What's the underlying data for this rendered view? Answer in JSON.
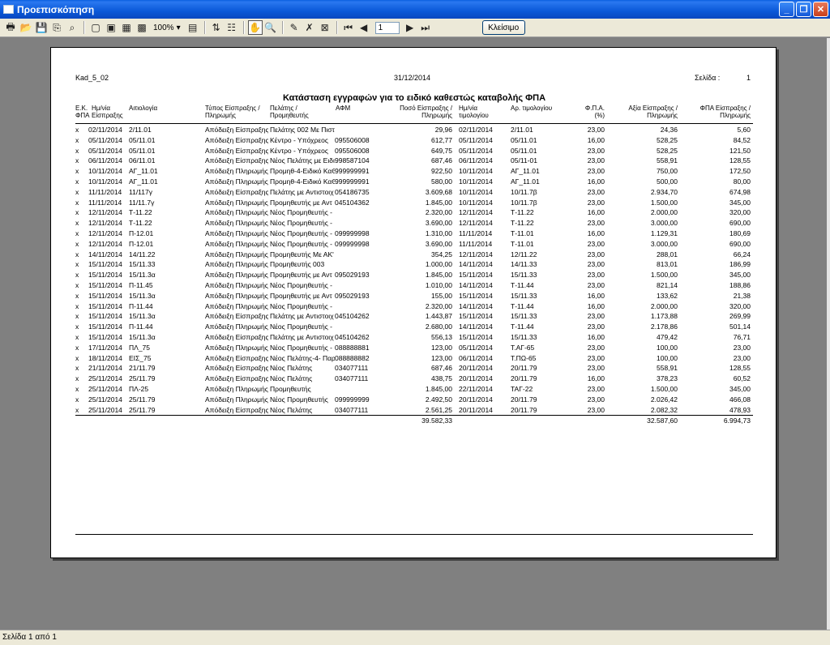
{
  "window": {
    "title": "Προεπισκόπηση",
    "minimize": "_",
    "maximize": "❐",
    "close": "✕"
  },
  "toolbar": {
    "icons": [
      "print-icon",
      "open-icon",
      "save-icon",
      "export-icon",
      "find-icon",
      "one-page-icon",
      "two-page-icon",
      "multi-page-icon",
      "grid-page-icon"
    ],
    "zoom": "100%",
    "page_number": "1",
    "close_label": "Κλείσιμο"
  },
  "report": {
    "code": "Kad_5_02",
    "date": "31/12/2014",
    "page_label": "Σελίδα :",
    "page_number": "1",
    "title": "Κατάσταση εγγραφών για το ειδικό καθεστώς καταβολής ΦΠΑ",
    "columns": {
      "ek": "Ε.Κ.\nΦΠΑ",
      "date": "Ημ/νία\nΕίσπραξης",
      "desc": "Αιτιολογία",
      "type": "Τύπος Είσπραξης /\nΠληρωμής",
      "party": "Πελάτης /\nΠρομηθευτής",
      "afm": "ΑΦΜ",
      "amount": "Ποσό Είσπραξης /\nΠληρωμής",
      "inv_date": "Ημ/νία\nτιμολογίου",
      "inv_no": "Αρ. τιμολογίου",
      "vat_pct": "Φ.Π.Α.\n(%)",
      "value": "Αξία Είσπραξης /\nΠληρωμής",
      "vat": "ΦΠΑ Είσπραξης /\nΠληρωμής"
    },
    "rows": [
      [
        "x",
        "02/11/2014",
        "2/11.01",
        "Απόδειξη Είσπραξης",
        "Πελάτης 002 Με Πιστ",
        "",
        "29,96",
        "02/11/2014",
        "2/11.01",
        "23,00",
        "24,36",
        "5,60"
      ],
      [
        "x",
        "05/11/2014",
        "05/11.01",
        "Απόδειξη Είσπραξης",
        "Κέντρο - Υπόχρεος",
        "095506008",
        "612,77",
        "05/11/2014",
        "05/11.01",
        "16,00",
        "528,25",
        "84,52"
      ],
      [
        "x",
        "05/11/2014",
        "05/11.01",
        "Απόδειξη Είσπραξης",
        "Κέντρο - Υπόχρεος",
        "095506008",
        "649,75",
        "05/11/2014",
        "05/11.01",
        "23,00",
        "528,25",
        "121,50"
      ],
      [
        "x",
        "06/11/2014",
        "06/11.01",
        "Απόδειξη Είσπραξης",
        "Νέος Πελάτης με Ειδι",
        "998587104",
        "687,46",
        "06/11/2014",
        "05/11-01",
        "23,00",
        "558,91",
        "128,55"
      ],
      [
        "x",
        "10/11/2014",
        "ΑΓ_11.01",
        "Απόδειξη Πληρωμής",
        "Προμηθ-4-Ειδικό ΚαΘ",
        "999999991",
        "922,50",
        "10/11/2014",
        "ΑΓ_11.01",
        "23,00",
        "750,00",
        "172,50"
      ],
      [
        "x",
        "10/11/2014",
        "ΑΓ_11.01",
        "Απόδειξη Πληρωμής",
        "Προμηθ-4-Ειδικό ΚαΘ",
        "999999991",
        "580,00",
        "10/11/2014",
        "ΑΓ_11.01",
        "16,00",
        "500,00",
        "80,00"
      ],
      [
        "x",
        "11/11/2014",
        "11/117γ",
        "Απόδειξη Είσπραξης",
        "Πελάτης με Αντιστοιχ",
        "054186735",
        "3.609,68",
        "10/11/2014",
        "10/11.7β",
        "23,00",
        "2.934,70",
        "674,98"
      ],
      [
        "x",
        "11/11/2014",
        "11/11.7γ",
        "Απόδειξη Πληρωμής",
        "Προμηθευτής με Αντ",
        "045104362",
        "1.845,00",
        "10/11/2014",
        "10/11.7β",
        "23,00",
        "1.500,00",
        "345,00"
      ],
      [
        "x",
        "12/11/2014",
        "Τ-11.22",
        "Απόδειξη Πληρωμής",
        "Νέος Προμηθευτής -",
        "",
        "2.320,00",
        "12/11/2014",
        "Τ-11.22",
        "16,00",
        "2.000,00",
        "320,00"
      ],
      [
        "x",
        "12/11/2014",
        "Τ-11.22",
        "Απόδειξη Πληρωμής",
        "Νέος Προμηθευτής -",
        "",
        "3.690,00",
        "12/11/2014",
        "Τ-11.22",
        "23,00",
        "3.000,00",
        "690,00"
      ],
      [
        "x",
        "12/11/2014",
        "Π-12.01",
        "Απόδειξη Πληρωμής",
        "Νέος Προμηθευτής -",
        "099999998",
        "1.310,00",
        "11/11/2014",
        "Τ-11.01",
        "16,00",
        "1.129,31",
        "180,69"
      ],
      [
        "x",
        "12/11/2014",
        "Π-12.01",
        "Απόδειξη Πληρωμής",
        "Νέος Προμηθευτής -",
        "099999998",
        "3.690,00",
        "11/11/2014",
        "Τ-11.01",
        "23,00",
        "3.000,00",
        "690,00"
      ],
      [
        "x",
        "14/11/2014",
        "14/11.22",
        "Απόδειξη Πληρωμής",
        "Προμηθευτής Με ΑΚ'",
        "",
        "354,25",
        "12/11/2014",
        "12/11.22",
        "23,00",
        "288,01",
        "66,24"
      ],
      [
        "x",
        "15/11/2014",
        "15/11.33",
        "Απόδειξη Πληρωμής",
        "Προμηθευτής 003",
        "",
        "1.000,00",
        "14/11/2014",
        "14/11.33",
        "23,00",
        "813,01",
        "186,99"
      ],
      [
        "x",
        "15/11/2014",
        "15/11.3α",
        "Απόδειξη Πληρωμής",
        "Προμηθευτής με Αντ",
        "095029193",
        "1.845,00",
        "15/11/2014",
        "15/11.33",
        "23,00",
        "1.500,00",
        "345,00"
      ],
      [
        "x",
        "15/11/2014",
        "Π-11.45",
        "Απόδειξη Πληρωμής",
        "Νέος Προμηθευτής -",
        "",
        "1.010,00",
        "14/11/2014",
        "Τ-11.44",
        "23,00",
        "821,14",
        "188,86"
      ],
      [
        "x",
        "15/11/2014",
        "15/11.3α",
        "Απόδειξη Πληρωμής",
        "Προμηθευτής με Αντ",
        "095029193",
        "155,00",
        "15/11/2014",
        "15/11.33",
        "16,00",
        "133,62",
        "21,38"
      ],
      [
        "x",
        "15/11/2014",
        "Π-11.44",
        "Απόδειξη Πληρωμής",
        "Νέος Προμηθευτής -",
        "",
        "2.320,00",
        "14/11/2014",
        "Τ-11.44",
        "16,00",
        "2.000,00",
        "320,00"
      ],
      [
        "x",
        "15/11/2014",
        "15/11.3α",
        "Απόδειξη Είσπραξης",
        "Πελάτης με Αντιστοιχ",
        "045104262",
        "1.443,87",
        "15/11/2014",
        "15/11.33",
        "23,00",
        "1.173,88",
        "269,99"
      ],
      [
        "x",
        "15/11/2014",
        "Π-11.44",
        "Απόδειξη Πληρωμής",
        "Νέος Προμηθευτής -",
        "",
        "2.680,00",
        "14/11/2014",
        "Τ-11.44",
        "23,00",
        "2.178,86",
        "501,14"
      ],
      [
        "x",
        "15/11/2014",
        "15/11.3α",
        "Απόδειξη Είσπραξης",
        "Πελάτης με Αντιστοιχ",
        "045104262",
        "556,13",
        "15/11/2014",
        "15/11.33",
        "16,00",
        "479,42",
        "76,71"
      ],
      [
        "x",
        "17/11/2014",
        "ΠΛ_75",
        "Απόδειξη Πληρωμής",
        "Νέος Προμηθευτής -",
        "088888881",
        "123,00",
        "05/11/2014",
        "Τ.ΑΓ-65",
        "23,00",
        "100,00",
        "23,00"
      ],
      [
        "x",
        "18/11/2014",
        "ΕΙΣ_75",
        "Απόδειξη Είσπραξης",
        "Νέος Πελάτης-4- Παρ",
        "088888882",
        "123,00",
        "06/11/2014",
        "Τ.ΠΩ-65",
        "23,00",
        "100,00",
        "23,00"
      ],
      [
        "x",
        "21/11/2014",
        "21/11.79",
        "Απόδειξη Είσπραξης",
        "Νέος Πελάτης",
        "034077111",
        "687,46",
        "20/11/2014",
        "20/11.79",
        "23,00",
        "558,91",
        "128,55"
      ],
      [
        "x",
        "25/11/2014",
        "25/11.79",
        "Απόδειξη Είσπραξης",
        "Νέος Πελάτης",
        "034077111",
        "438,75",
        "20/11/2014",
        "20/11.79",
        "16,00",
        "378,23",
        "60,52"
      ],
      [
        "x",
        "25/11/2014",
        "ΠΛ-25",
        "Απόδειξη Πληρωμής",
        "Προμηθευτής",
        "",
        "1.845,00",
        "22/11/2014",
        "ΤΑΓ-22",
        "23,00",
        "1.500,00",
        "345,00"
      ],
      [
        "x",
        "25/11/2014",
        "25/11.79",
        "Απόδειξη Πληρωμής",
        "Νέος Προμηθευτής",
        "099999999",
        "2.492,50",
        "20/11/2014",
        "20/11.79",
        "23,00",
        "2.026,42",
        "466,08"
      ],
      [
        "x",
        "25/11/2014",
        "25/11.79",
        "Απόδειξη Είσπραξης",
        "Νέος Πελάτης",
        "034077111",
        "2.561,25",
        "20/11/2014",
        "20/11.79",
        "23,00",
        "2.082,32",
        "478,93"
      ]
    ],
    "totals": {
      "amount": "39.582,33",
      "value": "32.587,60",
      "vat": "6.994,73"
    }
  },
  "status": {
    "text": "Σελίδα 1 από 1"
  }
}
